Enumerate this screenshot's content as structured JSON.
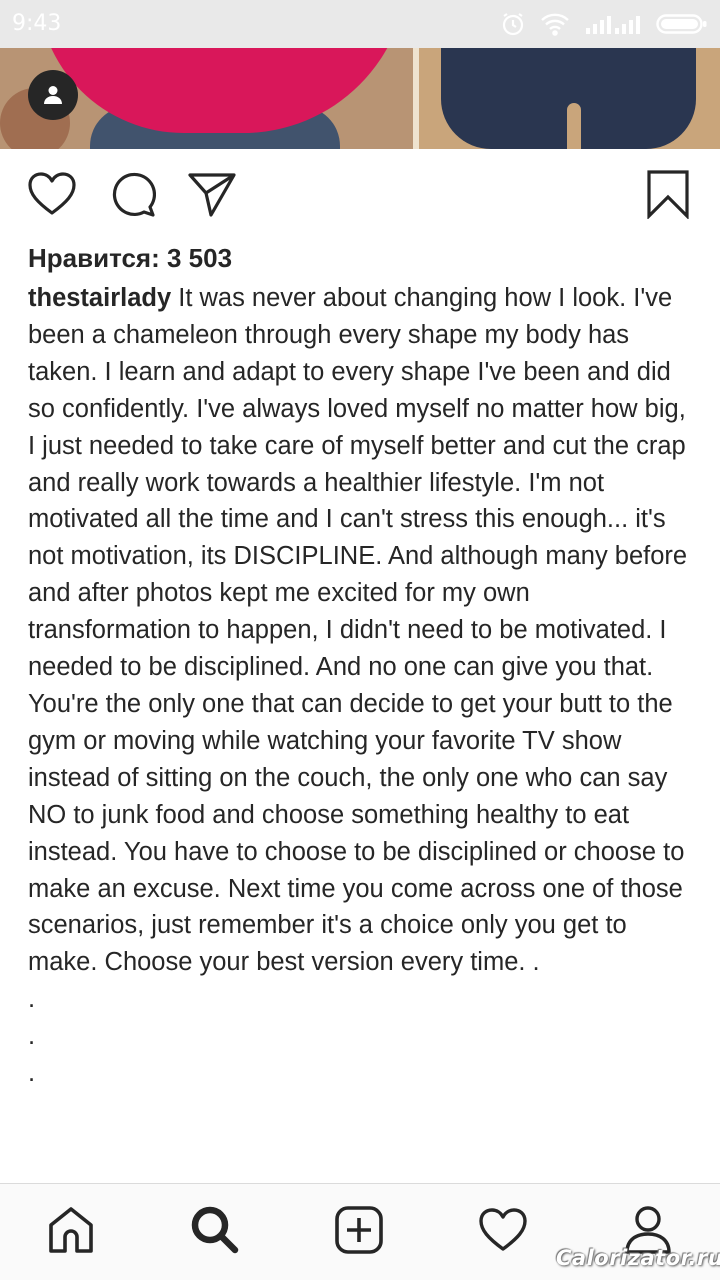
{
  "status_bar": {
    "time": "9:43",
    "icons": [
      "alarm-icon",
      "wifi-icon",
      "signal-icon",
      "battery-icon"
    ]
  },
  "post": {
    "actions": [
      "heart-icon",
      "comment-icon",
      "share-icon",
      "bookmark-icon"
    ],
    "likes_text": "Нравится: 3 503",
    "username": "thestairlady",
    "caption": "It was never about changing how I look. I've been a chameleon through every shape my body has taken. I learn and adapt to every shape I've been and did so confidently. I've always loved myself no matter how big, I just needed to take care of myself better and cut the crap and really work towards a healthier lifestyle. I'm not motivated all the time and I can't stress this enough... it's not motivation, its DISCIPLINE. And although many before and after photos kept me excited for my own transformation to happen, I didn't need to be motivated. I needed to be disciplined. And no one can give you that. You're the only one that can decide to get your butt to the gym or moving while watching your favorite TV show instead of sitting on the couch, the only one who can say NO to junk food and choose something healthy to eat instead. You have to choose to be disciplined or choose to make an excuse. Next time you come across one of those scenarios, just remember it's a choice only you get to make. Choose your best version every time. .\n.\n.\n."
  },
  "bottom_nav": {
    "items": [
      "home-icon",
      "search-icon",
      "add-post-icon",
      "activity-heart-icon",
      "profile-icon"
    ]
  },
  "watermark": "Calorizator.ru",
  "colors": {
    "text": "#262626",
    "status_bar": "#e9e9e9",
    "nav_background": "#fafafa"
  }
}
